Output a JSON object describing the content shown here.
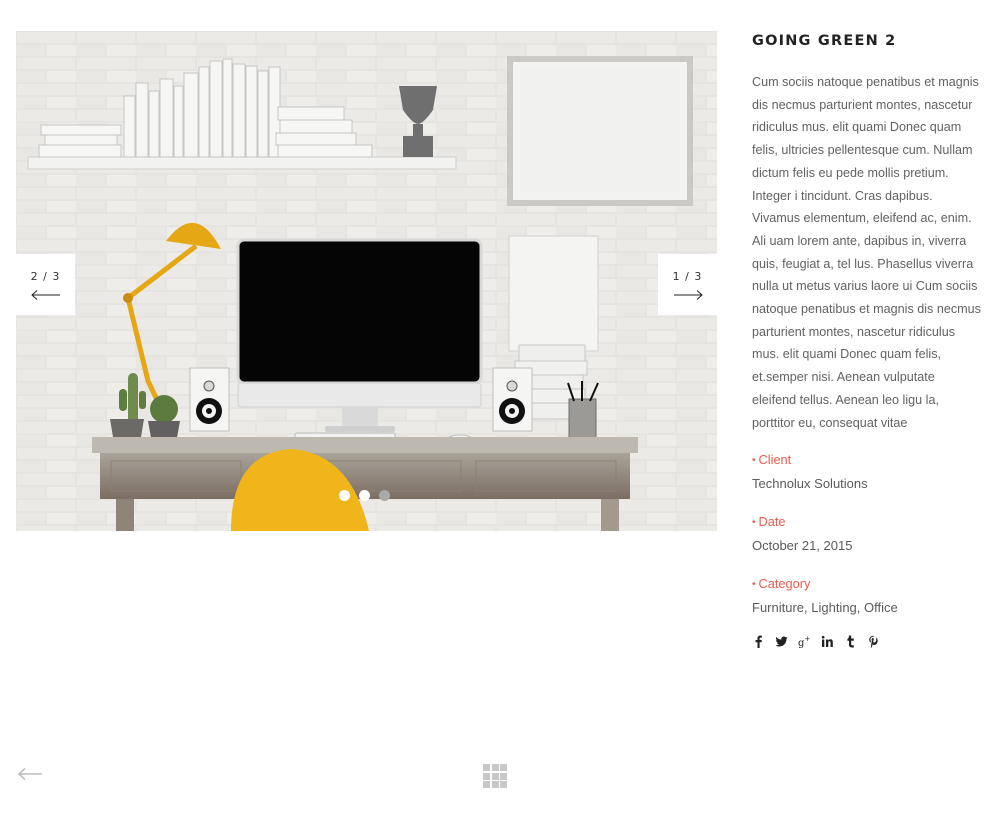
{
  "project": {
    "title": "GOING GREEN 2",
    "description": "Cum sociis natoque penatibus et magnis dis necmus parturient montes, nascetur ridiculus mus. elit quami Donec quam felis, ultricies pellentesque cum. Nullam dictum felis eu pede mollis pretium. Integer i tincidunt. Cras dapibus. Vivamus elementum, eleifend ac, enim. Ali uam lorem ante, dapibus in, viverra quis, feugiat a, tel lus. Phasellus viverra nulla ut metus varius laore ui Cum sociis natoque penatibus et magnis dis necmus parturient montes, nascetur ridiculus mus. elit quami Donec quam felis, et.semper nisi. Aenean vulputate eleifend tellus. Aenean leo ligu la, porttitor eu, consequat vitae",
    "meta": [
      {
        "label": "Client",
        "value": "Technolux Solutions"
      },
      {
        "label": "Date",
        "value": "October 21, 2015"
      },
      {
        "label": "Category",
        "value": "Furniture, Lighting, Office"
      }
    ]
  },
  "slider": {
    "prev_label": "2 / 3",
    "next_label": "1 / 3",
    "dots": {
      "count": 3,
      "active_index": 1
    }
  },
  "social_icons": [
    "facebook-icon",
    "twitter-icon",
    "google-plus-icon",
    "linkedin-icon",
    "tumblr-icon",
    "pinterest-icon"
  ],
  "footer_nav": {
    "back_icon": "arrow-left-icon",
    "grid_icon": "grid-icon"
  },
  "colors": {
    "accent": "#ef5a4c",
    "title": "#222222",
    "text": "#626262",
    "icon_gray": "#c7c7c7",
    "lamp_yellow": "#e5a713"
  }
}
